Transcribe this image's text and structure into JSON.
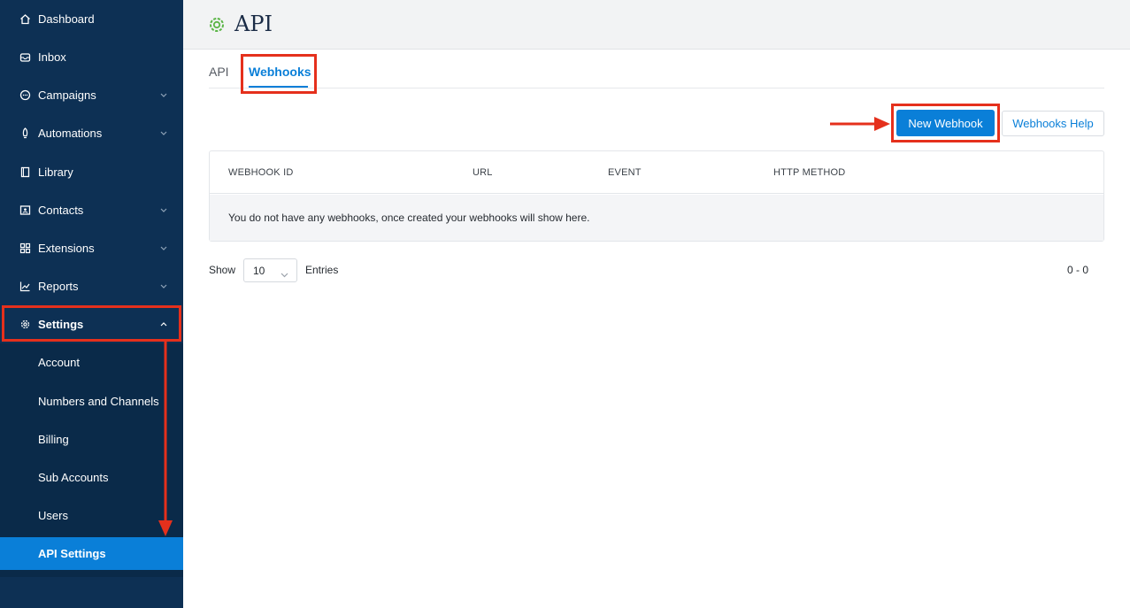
{
  "sidebar": {
    "items": [
      {
        "label": "Dashboard",
        "icon": "home-icon"
      },
      {
        "label": "Inbox",
        "icon": "inbox-icon"
      },
      {
        "label": "Campaigns",
        "icon": "chat-icon"
      },
      {
        "label": "Automations",
        "icon": "rocket-icon"
      },
      {
        "label": "Library",
        "icon": "book-icon"
      },
      {
        "label": "Contacts",
        "icon": "contact-card-icon"
      },
      {
        "label": "Extensions",
        "icon": "grid-icon"
      },
      {
        "label": "Reports",
        "icon": "chart-icon"
      },
      {
        "label": "Settings",
        "icon": "gear-icon"
      }
    ],
    "sub_items": [
      {
        "label": "Account"
      },
      {
        "label": "Numbers and Channels"
      },
      {
        "label": "Billing"
      },
      {
        "label": "Sub Accounts"
      },
      {
        "label": "Users"
      },
      {
        "label": "API Settings"
      }
    ]
  },
  "header": {
    "title": "API",
    "icon": "gear-icon"
  },
  "tabs": [
    {
      "label": "API"
    },
    {
      "label": "Webhooks"
    }
  ],
  "actions": {
    "new_webhook": "New Webhook",
    "help": "Webhooks Help"
  },
  "table": {
    "columns": [
      "WEBHOOK ID",
      "URL",
      "EVENT",
      "HTTP METHOD"
    ],
    "empty_message": "You do not have any webhooks, once created your webhooks will show here."
  },
  "pagination": {
    "show_label": "Show",
    "page_size": "10",
    "entries_label": "Entries",
    "range": "0 - 0"
  },
  "colors": {
    "sidebar": "#0d3054",
    "accent": "#0a7fd8",
    "highlight": "#e5301c",
    "title_icon": "#5bb547"
  }
}
